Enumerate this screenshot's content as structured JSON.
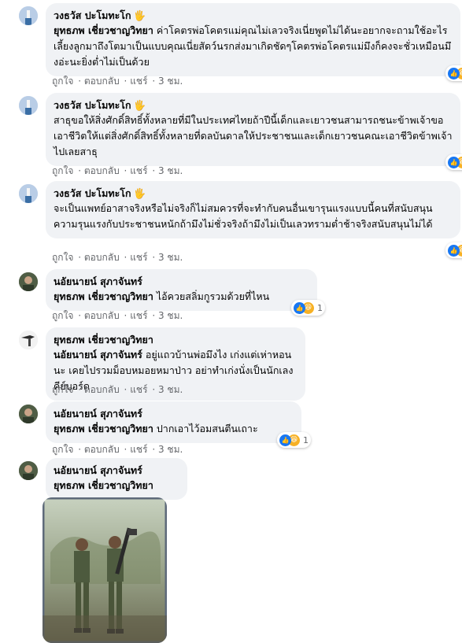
{
  "comments": [
    {
      "author": "วงธวัส ปะโมทะโก",
      "badge": "🖐",
      "tag": "ยุทธภพ เชี่ยวชาญวิทยา",
      "text": "ค่าโคตรพ่อโคตรแม่คุณไม่เลวจริงเนี่ยพูดไม่ได้นะอยากจะถามใช้อะไรเลี้ยงลูกมาถึงโตมาเป็นแบบคุณเนี่ยสัดว์นรกส่งมาเกิดชัดๆโคตรพ่อโคตรแม่มึงก็คงจะชั่วเหมือนมึงอ่ะนะยิ่งต่ำไม่เป็นด้วย",
      "like": "ถูกใจ",
      "reply": "ตอบกลับ",
      "share": "แชร์",
      "time": "3 ชม."
    },
    {
      "author": "วงธวัส ปะโมทะโก",
      "badge": "🖐",
      "text": "สาธุขอให้สิ่งศักดิ์สิทธิ์ทั้งหลายที่มีในประเทศไทยถ้าปีนี้เด็กและเยาวชนสามารถชนะข้าพเจ้าขอเอาชีวิตให้แต่สิ่งศักดิ์สิทธิ์ทั้งหลายที่ดลบันดาลให้ประชาชนและเด็กเยาวชนคณะเอาชีวิตข้าพเจ้าไปเลยสาธุ",
      "like": "ถูกใจ",
      "reply": "ตอบกลับ",
      "share": "แชร์",
      "time": "3 ชม."
    },
    {
      "author": "วงธวัส ปะโมทะโก",
      "badge": "🖐",
      "text": "จะเป็นแพทย์อาสาจริงหรือไม่จริงก็ไม่สมควรที่จะทำกับคนอื่นเขารุนแรงแบบนี้คนที่สนับสนุนความรุนแรงกับประชาชนหนักถ้ามึงไม่ชั่วจริงถ้ามึงไม่เป็นเลวทรามต่ำช้าจริงสนับสนุนไม่ได้",
      "like": "ถูกใจ",
      "reply": "ตอบกลับ",
      "share": "แชร์",
      "time": "3 ชม."
    },
    {
      "author": "นอัยนายน์ สุภาจันทร์",
      "tag": "ยุทธภพ เชี่ยวชาญวิทยา",
      "text": "ไอ้ควยสลิ่มกูรวมด้วยที่ไหน",
      "like": "ถูกใจ",
      "reply": "ตอบกลับ",
      "share": "แชร์",
      "time": "3 ชม.",
      "reaction_count": "1"
    },
    {
      "author": "ยุทธภพ เชี่ยวชาญวิทยา",
      "tag": "นอัยนายน์ สุภาจันทร์",
      "text": "อยู่แถวบ้านพ่อมึงไง เก่งแต่เห่าหอนนะ เคยไปรวมม็อบหมอยหมาป่าว อย่าทำเก่งนั่งเป็นนักเลงคีย์บอร์ด",
      "like": "ถูกใจ",
      "reply": "ตอบกลับ",
      "share": "แชร์",
      "time": "3 ชม."
    },
    {
      "author": "นอัยนายน์ สุภาจันทร์",
      "tag": "ยุทธภพ เชี่ยวชาญวิทยา",
      "text": "ปากเอาไว้อมสนตีนเถาะ",
      "like": "ถูกใจ",
      "reply": "ตอบกลับ",
      "share": "แชร์",
      "time": "3 ชม.",
      "reaction_count": "1"
    },
    {
      "author": "นอัยนายน์ สุภาจันทร์",
      "tag": "ยุทธภพ เชี่ยวชาญวิทยา"
    }
  ],
  "colors": {
    "bubble": "#f0f2f5",
    "meta": "#65676b",
    "like": "#1877f2",
    "haha": "#f7b125"
  },
  "icons": {
    "reaction": "like-haha-reaction-icon",
    "badge": "waving-hand-icon"
  }
}
